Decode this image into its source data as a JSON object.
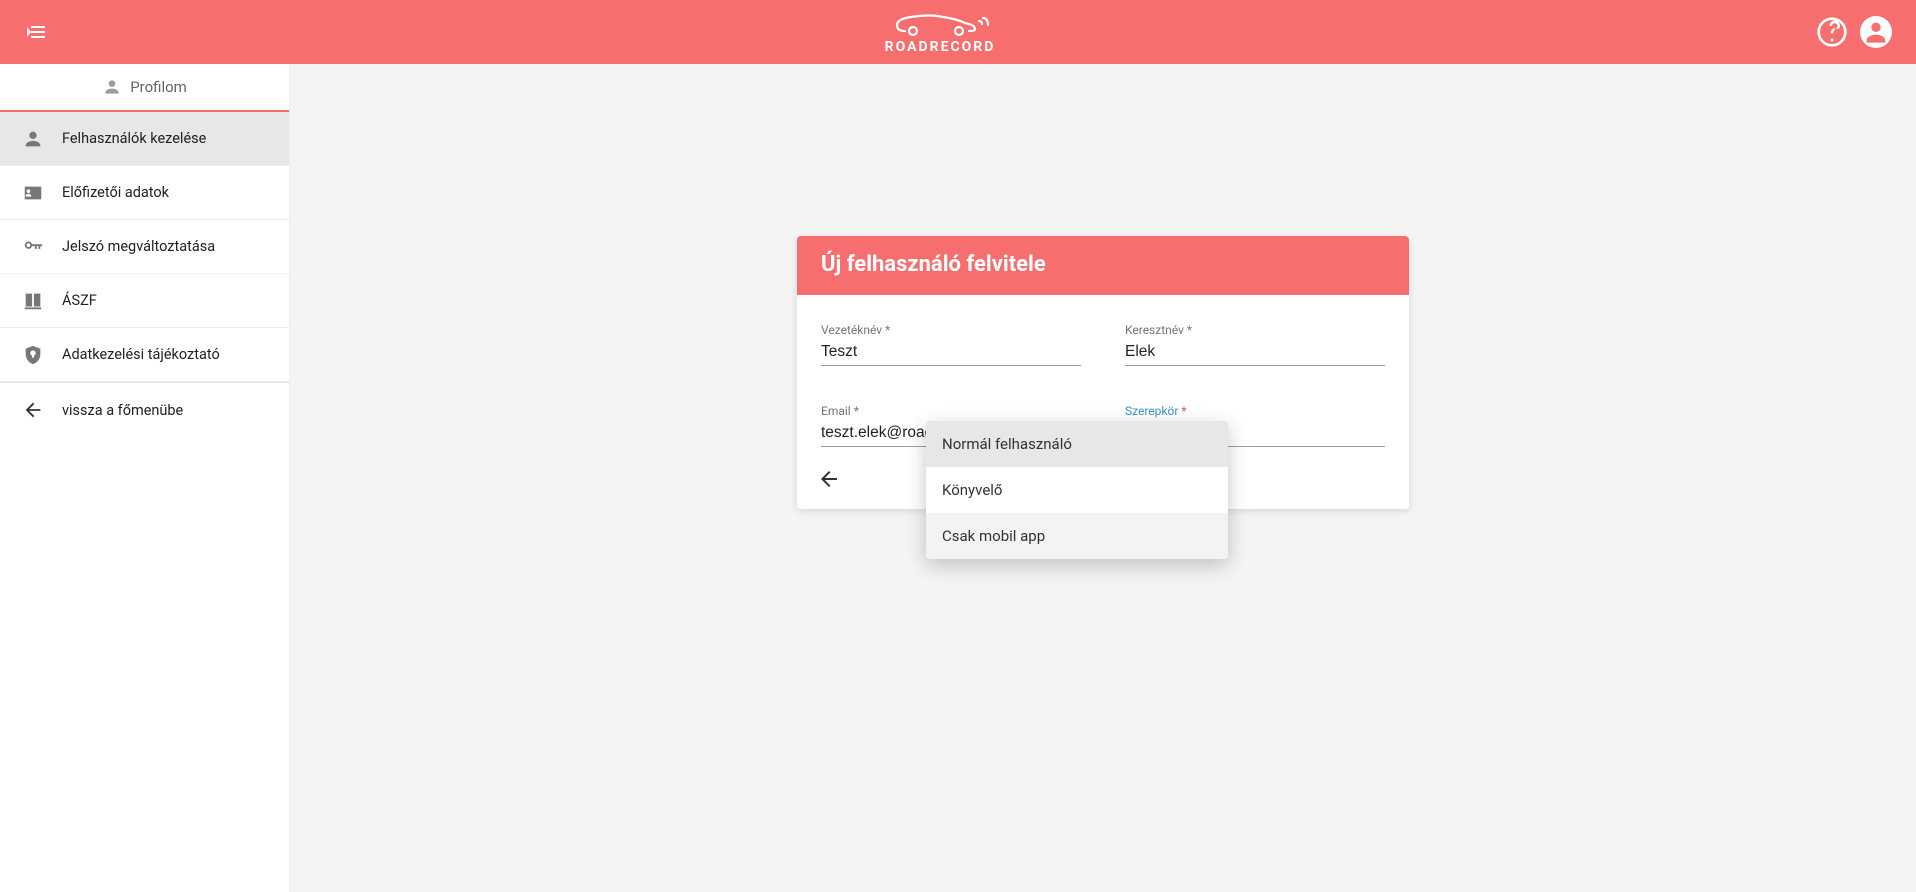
{
  "header": {
    "brand": "ROADRECORD"
  },
  "sidebar": {
    "title": "Profilom",
    "items": [
      {
        "label": "Felhasználók kezelése"
      },
      {
        "label": "Előfizetői adatok"
      },
      {
        "label": "Jelszó megváltoztatása"
      },
      {
        "label": "ÁSZF"
      },
      {
        "label": "Adatkezelési tájékoztató"
      }
    ],
    "back_label": "vissza a főmenübe"
  },
  "card": {
    "title": "Új felhasználó felvitele",
    "fields": {
      "lastname_label": "Vezetéknév",
      "lastname_value": "Teszt",
      "firstname_label": "Keresztnév",
      "firstname_value": "Elek",
      "email_label": "Email",
      "email_value": "teszt.elek@roadrecord.hu",
      "role_label": "Szerepkör"
    },
    "required_mark": "*"
  },
  "role_menu": {
    "options": [
      "Normál felhasználó",
      "Könyvelő",
      "Csak mobil app"
    ]
  }
}
